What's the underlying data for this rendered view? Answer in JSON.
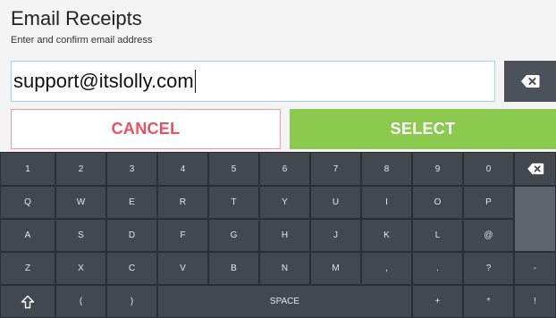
{
  "header": {
    "title": "Email Receipts",
    "subtitle": "Enter and confirm email address"
  },
  "input": {
    "value": "support@itslolly.com"
  },
  "buttons": {
    "cancel_label": "CANCEL",
    "select_label": "SELECT"
  },
  "colors": {
    "accent_green": "#8bc94f",
    "cancel_red": "#e8515f",
    "keyboard_bg": "#2d3237",
    "key_bg": "#42484e"
  },
  "keyboard": {
    "rows": [
      [
        "1",
        "2",
        "3",
        "4",
        "5",
        "6",
        "7",
        "8",
        "9",
        "0"
      ],
      [
        "Q",
        "W",
        "E",
        "R",
        "T",
        "Y",
        "U",
        "I",
        "O",
        "P"
      ],
      [
        "A",
        "S",
        "D",
        "F",
        "G",
        "H",
        "J",
        "K",
        "L",
        "@"
      ],
      [
        "Z",
        "X",
        "C",
        "V",
        "B",
        "N",
        "M",
        ",",
        ".",
        "?",
        "-"
      ]
    ],
    "bottom": {
      "left_paren": "(",
      "right_paren": ")",
      "space": "SPACE",
      "plus": "+",
      "asterisk": "*",
      "exclaim": "!"
    },
    "icons": {
      "backspace": "backspace-icon",
      "shift": "shift-arrow-icon"
    }
  }
}
